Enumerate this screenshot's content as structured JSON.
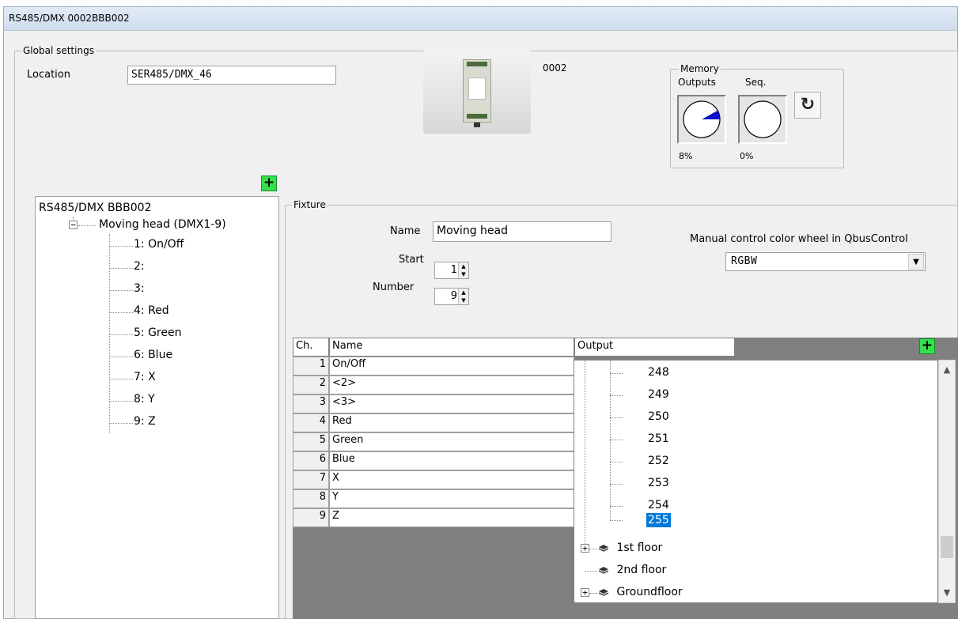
{
  "window": {
    "title": "RS485/DMX 0002BBB002"
  },
  "global_settings": {
    "legend": "Global settings",
    "location_label": "Location",
    "location_value": "SER485/DMX_46",
    "device_id": "0002",
    "memory": {
      "legend": "Memory",
      "outputs_label": "Outputs",
      "seq_label": "Seq.",
      "outputs_percent": "8%",
      "seq_percent": "0%",
      "outputs_fraction": 0.08,
      "seq_fraction": 0.0
    }
  },
  "tree": {
    "root": "RS485/DMX BBB002",
    "fixture": "Moving head (DMX1-9)",
    "channels": [
      "1: On/Off",
      "2:",
      "3:",
      "4: Red",
      "5: Green",
      "6: Blue",
      "7: X",
      "8: Y",
      "9: Z"
    ]
  },
  "fixture": {
    "legend": "Fixture",
    "name_label": "Name",
    "name_value": "Moving head",
    "start_label": "Start",
    "start_value": "1",
    "number_label": "Number",
    "number_value": "9",
    "color_wheel_label": "Manual control color wheel in QbusControl",
    "color_wheel_value": "RGBW"
  },
  "grid": {
    "headers": {
      "ch": "Ch.",
      "name": "Name",
      "output": "Output"
    },
    "rows": [
      {
        "ch": "1",
        "name": "On/Off"
      },
      {
        "ch": "2",
        "name": "<2>"
      },
      {
        "ch": "3",
        "name": "<3>"
      },
      {
        "ch": "4",
        "name": "Red"
      },
      {
        "ch": "5",
        "name": "Green"
      },
      {
        "ch": "6",
        "name": "Blue"
      },
      {
        "ch": "7",
        "name": "X"
      },
      {
        "ch": "8",
        "name": "Y"
      },
      {
        "ch": "9",
        "name": "Z"
      }
    ]
  },
  "output_dropdown": {
    "items": [
      "248",
      "249",
      "250",
      "251",
      "252",
      "253",
      "254",
      "255"
    ],
    "selected": "255",
    "groups": [
      "1st floor",
      "2nd floor",
      "Groundfloor"
    ]
  },
  "icons": {
    "add": "plus-icon",
    "refresh": "refresh-icon",
    "group": "layer-icon"
  },
  "colors": {
    "add_button": "#33e04c",
    "selection": "#0078d7",
    "memory_fill": "#1010c8"
  }
}
